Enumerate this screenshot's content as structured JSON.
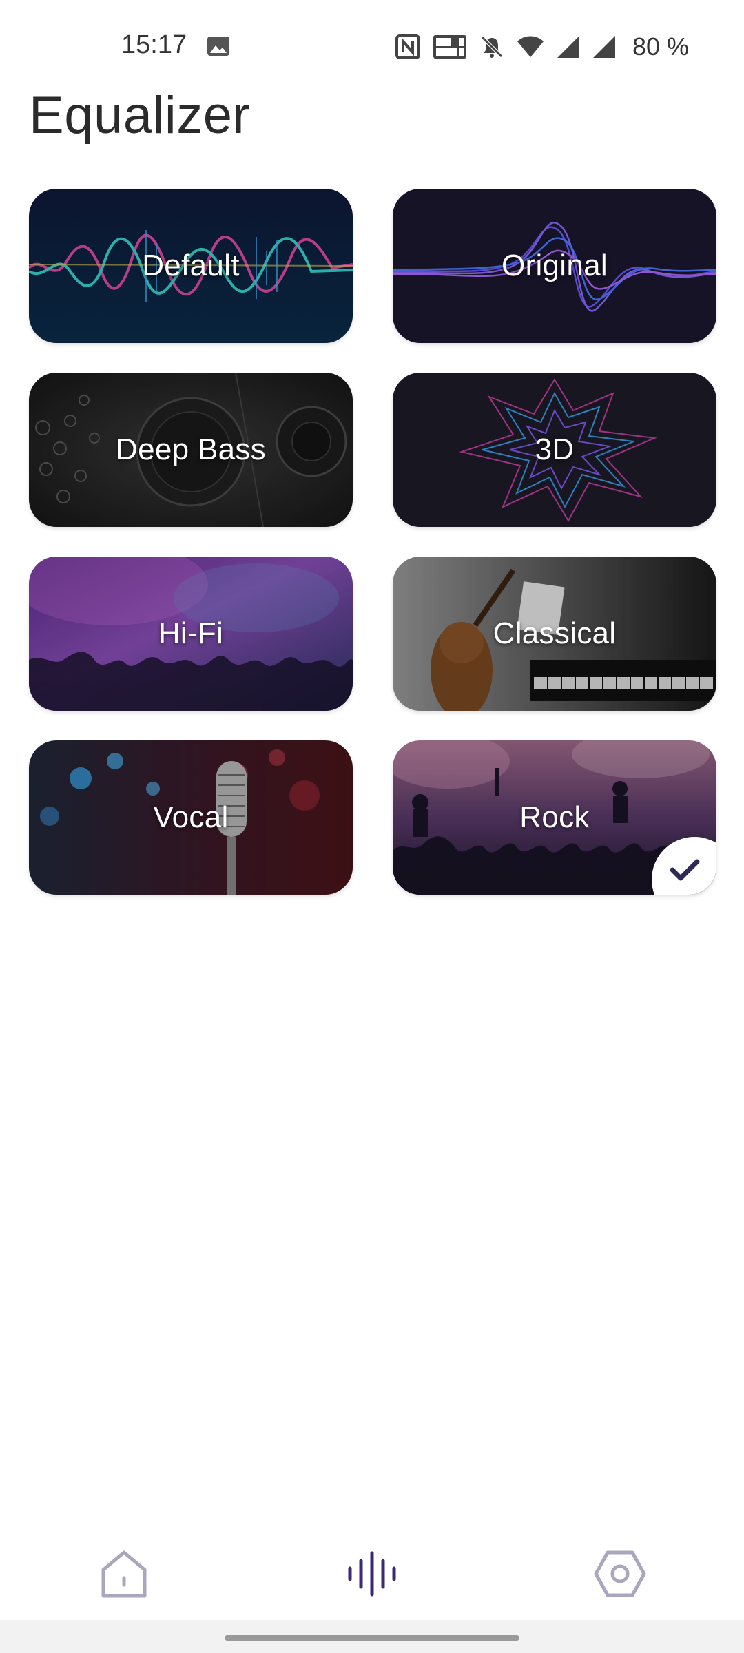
{
  "status_bar": {
    "time": "15:17",
    "battery": "80 %",
    "icons": [
      "gallery-icon",
      "nfc-icon",
      "volte-icon",
      "mute-icon",
      "wifi-icon",
      "signal-icon",
      "signal-icon-2"
    ]
  },
  "header": {
    "title": "Equalizer"
  },
  "presets": [
    {
      "label": "Default"
    },
    {
      "label": "Original"
    },
    {
      "label": "Deep Bass"
    },
    {
      "label": "3D"
    },
    {
      "label": "Hi-Fi"
    },
    {
      "label": "Classical"
    },
    {
      "label": "Vocal"
    },
    {
      "label": "Rock"
    }
  ],
  "selected_preset": "Rock",
  "bottom_nav": {
    "items": [
      {
        "icon": "home-icon",
        "active": false
      },
      {
        "icon": "equalizer-icon",
        "active": true
      },
      {
        "icon": "settings-icon",
        "active": false
      }
    ]
  },
  "colors": {
    "accent": "#3b2a73",
    "inactive_icon": "#a9a6bd"
  }
}
